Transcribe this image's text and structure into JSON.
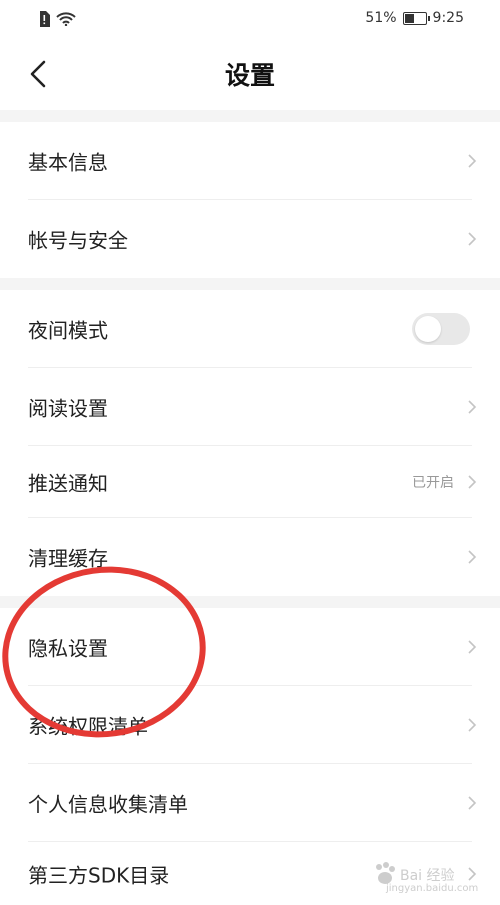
{
  "status_bar": {
    "battery_percent": "51%",
    "battery_level": 0.51,
    "time": "9:25"
  },
  "nav": {
    "title": "设置"
  },
  "sections": [
    {
      "items": [
        {
          "label": "基本信息",
          "type": "chevron"
        },
        {
          "label": "帐号与安全",
          "type": "chevron"
        }
      ]
    },
    {
      "items": [
        {
          "label": "夜间模式",
          "type": "toggle",
          "toggle_on": false
        },
        {
          "label": "阅读设置",
          "type": "chevron"
        },
        {
          "label": "推送通知",
          "type": "chevron",
          "value": "已开启"
        },
        {
          "label": "清理缓存",
          "type": "chevron"
        }
      ]
    },
    {
      "items": [
        {
          "label": "隐私设置",
          "type": "chevron"
        },
        {
          "label": "系统权限清单",
          "type": "chevron"
        },
        {
          "label": "个人信息收集清单",
          "type": "chevron"
        },
        {
          "label": "第三方SDK目录",
          "type": "chevron"
        }
      ]
    }
  ],
  "watermark": {
    "text": "Bai 经验",
    "sub": "jingyan.baidu.com"
  },
  "colors": {
    "annotation": "#e43a34",
    "section_gap": "#f4f4f4",
    "chevron": "#c4c4c4"
  }
}
